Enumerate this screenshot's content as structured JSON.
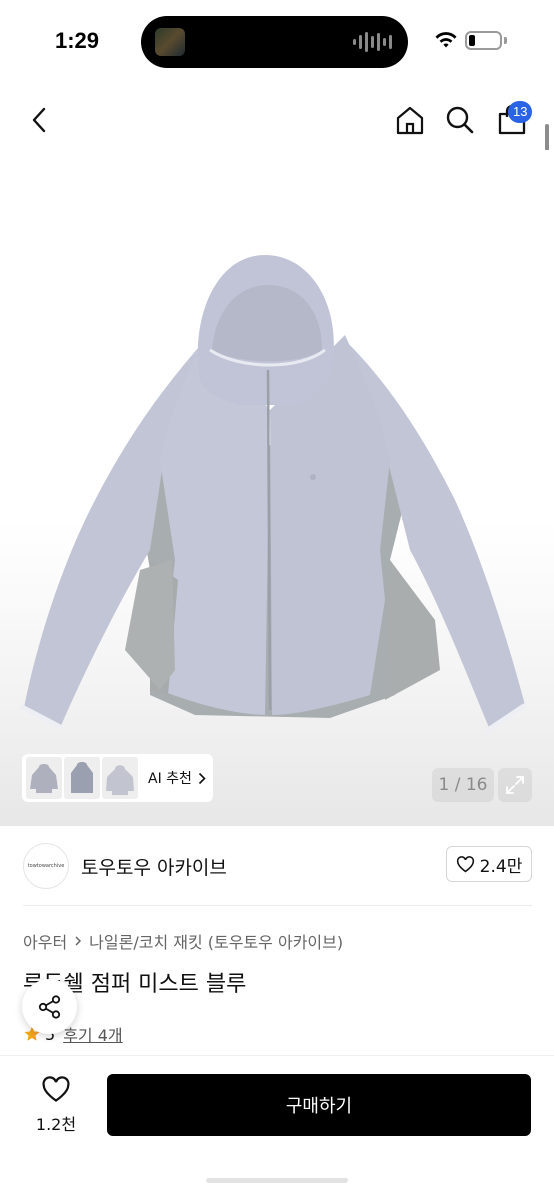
{
  "status_bar": {
    "time": "1:29",
    "battery_level": 0.2
  },
  "nav": {
    "back_icon": "chevron-left-icon",
    "home_icon": "home-icon",
    "search_icon": "search-icon",
    "cart_icon": "shopping-bag-icon",
    "cart_count": "13",
    "badge_color": "#2a63e6"
  },
  "gallery": {
    "ai_label": "AI 추천",
    "page_counter": "1 / 16",
    "thumbnails": [
      "jacket-front",
      "jacket-flat",
      "jacket-worn"
    ],
    "jacket_color": "#c3c6d6"
  },
  "shop": {
    "avatar_text": "towtowarchive",
    "name": "토우토우 아카이브",
    "likes": "2.4만"
  },
  "breadcrumb": {
    "category": "아우터",
    "subcategory": "나일론/코치 재킷 (토우토우 아카이브)"
  },
  "product": {
    "title": "루두쉘 점퍼 미스트 블루",
    "rating": "5",
    "reviews": "후기 4개"
  },
  "bottom": {
    "wish_count": "1.2천",
    "buy_label": "구매하기"
  }
}
